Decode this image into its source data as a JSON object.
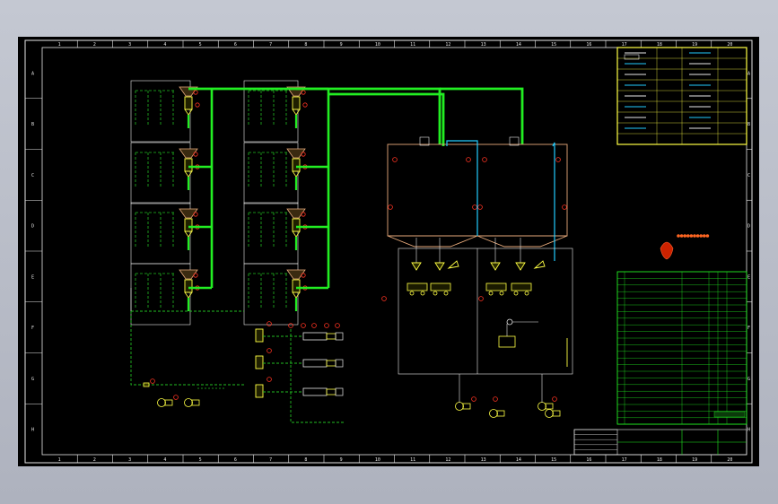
{
  "drawing": {
    "column_labels": [
      "1",
      "2",
      "3",
      "4",
      "5",
      "6",
      "7",
      "8",
      "9",
      "10",
      "11",
      "12",
      "13",
      "14",
      "15",
      "16",
      "17",
      "18",
      "19",
      "20"
    ],
    "row_labels": [
      "A",
      "B",
      "C",
      "D",
      "E",
      "F",
      "G",
      "H"
    ],
    "colors": {
      "background": "#000000",
      "frame": "#e8e8e8",
      "main_pipe": "#22ee22",
      "branch_pipe": "#22bb22",
      "silo_outline": "#e6a97a",
      "aux_pipe": "#22ccff",
      "equipment": "#ffff44",
      "mark": "#ff3322",
      "annotation": "#f0f0f0"
    }
  }
}
